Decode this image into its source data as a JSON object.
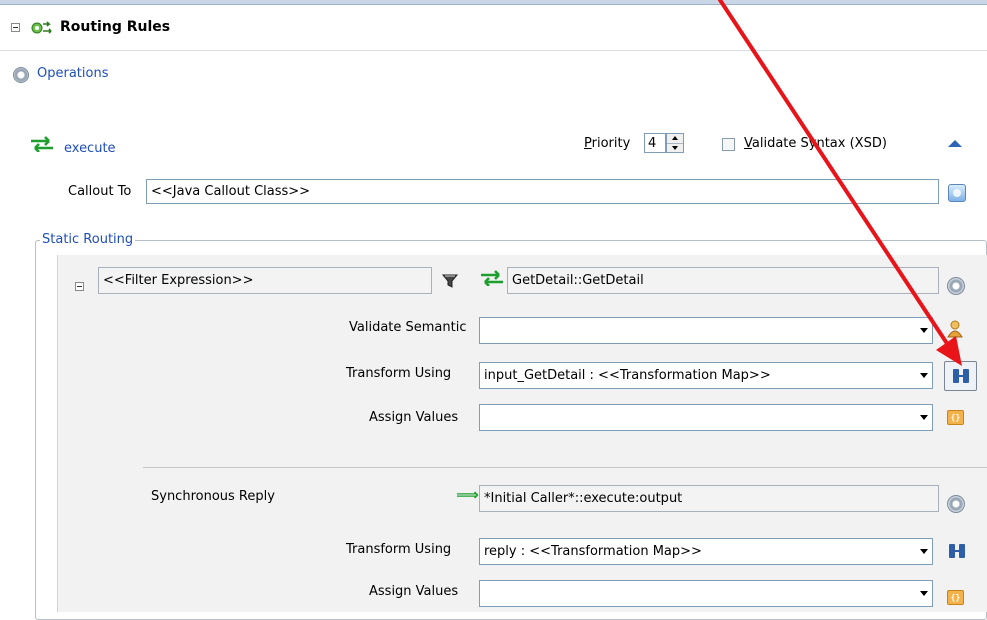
{
  "header": {
    "title": "Routing Rules"
  },
  "operations_link": "Operations",
  "route": {
    "name": "execute",
    "priority_label_first": "P",
    "priority_label_rest": "riority",
    "priority_value": "4",
    "validate_syntax_first": "V",
    "validate_syntax_rest": "alidate Syntax (XSD)"
  },
  "callout": {
    "label": "Callout To",
    "value": "<<Java Callout Class>>"
  },
  "static_routing": {
    "legend": "Static Routing",
    "filter_expression": "<<Filter Expression>>",
    "target": "GetDetail::GetDetail",
    "validate_semantic_label": "Validate Semantic",
    "validate_semantic_value": "",
    "transform_using_label": "Transform Using",
    "transform_using_value": "input_GetDetail : <<Transformation Map>>",
    "assign_values_label": "Assign Values",
    "assign_values_value": ""
  },
  "sync_reply": {
    "label": "Synchronous Reply",
    "target": "*Initial Caller*::execute:output",
    "transform_using_label": "Transform Using",
    "transform_using_value": "reply : <<Transformation Map>>",
    "assign_values_label": "Assign Values",
    "assign_values_value": ""
  },
  "colors": {
    "link": "#1f4fb8",
    "annotation_arrow": "#e8141a",
    "route_icon": "#1e9e2e"
  }
}
